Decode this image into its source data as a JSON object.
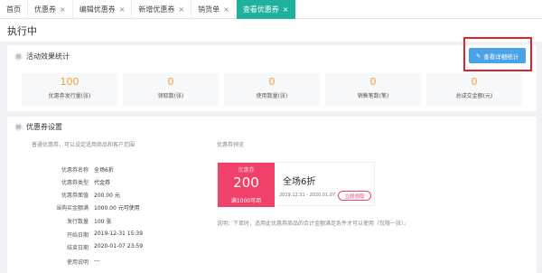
{
  "tabs": [
    {
      "label": "首页",
      "closable": false,
      "active": false
    },
    {
      "label": "优惠券",
      "closable": true,
      "active": false
    },
    {
      "label": "编辑优惠券",
      "closable": true,
      "active": false
    },
    {
      "label": "新增优惠券",
      "closable": true,
      "active": false
    },
    {
      "label": "销货单",
      "closable": true,
      "active": false
    },
    {
      "label": "查看优惠券",
      "closable": true,
      "active": true
    }
  ],
  "close_glyph": "×",
  "page": {
    "title": "执行中"
  },
  "stats_card": {
    "title": "活动效果统计",
    "detail_button": "查看详细统计",
    "stats": [
      {
        "value": "100",
        "label": "优惠券发行量(张)"
      },
      {
        "value": "0",
        "label": "领取数(张)"
      },
      {
        "value": "0",
        "label": "使用数量(张)"
      },
      {
        "value": "0",
        "label": "销售笔数(笔)"
      },
      {
        "value": "0",
        "label": "总成交金额(元)"
      }
    ]
  },
  "settings_card": {
    "title": "优惠券设置",
    "subtitle": "普通优惠券，可以设定适用商品和客户范围",
    "preview_label": "优惠券预览",
    "fields": [
      {
        "label": "优惠券名称",
        "value": "全场6折"
      },
      {
        "label": "优惠券类型",
        "value": "代金券"
      },
      {
        "label": "优惠券面值",
        "value": "200.00 元"
      },
      {
        "label": "当购买金额满",
        "value": "1000.00 元可使用"
      },
      {
        "label": "发行数量",
        "value": "100 张"
      },
      {
        "label": "开始日期",
        "value": "2019-12-31 15:39"
      },
      {
        "label": "结束日期",
        "value": "2020-01-07 23:59"
      },
      {
        "label": "使用说明",
        "value": "---"
      }
    ],
    "coupon": {
      "head": "优惠券",
      "amount": "200",
      "condition": "满1000可用",
      "name": "全场6折",
      "date_range": "2019.12.31 - 2020.01.07",
      "receive_button": "立即领取"
    },
    "note": "说明：下单时，适用此优惠券商品的合计金额满足条件才可以使用（仅限一张）。"
  },
  "colors": {
    "accent_tab": "#1fb19e",
    "stat_value": "#f0a030",
    "primary_button": "#4aa3e8",
    "highlight_box": "#e0232a",
    "coupon": "#f0416a"
  }
}
